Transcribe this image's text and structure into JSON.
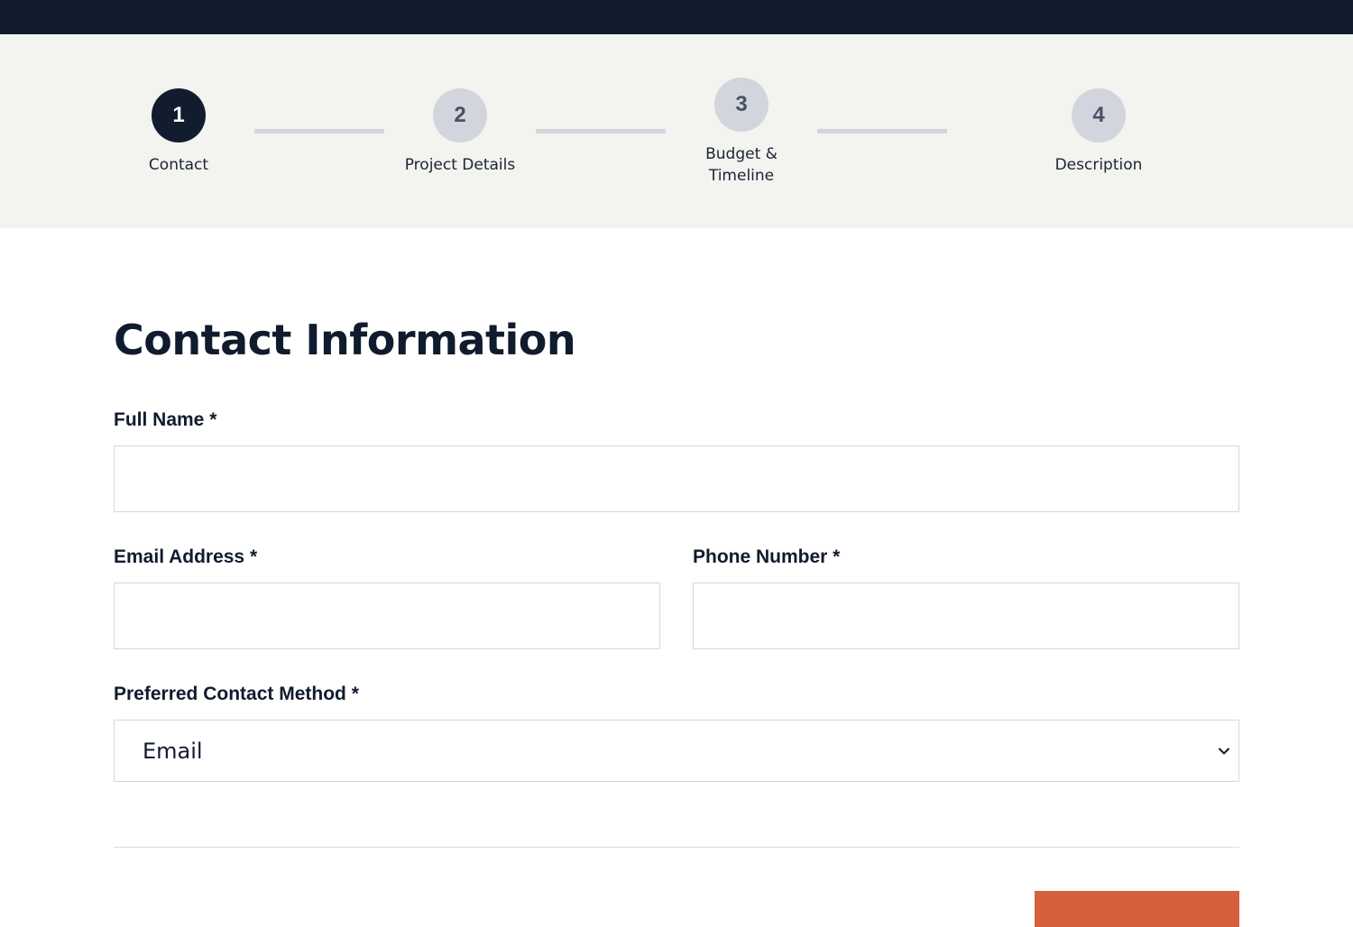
{
  "steps": [
    {
      "number": "1",
      "label": "Contact",
      "active": true
    },
    {
      "number": "2",
      "label": "Project Details",
      "active": false
    },
    {
      "number": "3",
      "label_line1": "Budget &",
      "label_line2": "Timeline",
      "active": false
    },
    {
      "number": "4",
      "label": "Description",
      "active": false
    }
  ],
  "form": {
    "title": "Contact Information",
    "full_name": {
      "label": "Full Name *",
      "value": ""
    },
    "email": {
      "label": "Email Address *",
      "value": ""
    },
    "phone": {
      "label": "Phone Number *",
      "value": ""
    },
    "contact_method": {
      "label": "Preferred Contact Method *",
      "selected": "Email"
    }
  },
  "colors": {
    "nav": "#111c2f",
    "stepper_bg": "#f3f3ef",
    "inactive_step": "#d2d5dd",
    "accent": "#d65f3c"
  },
  "icons": {
    "select": "chevron-down-icon"
  }
}
